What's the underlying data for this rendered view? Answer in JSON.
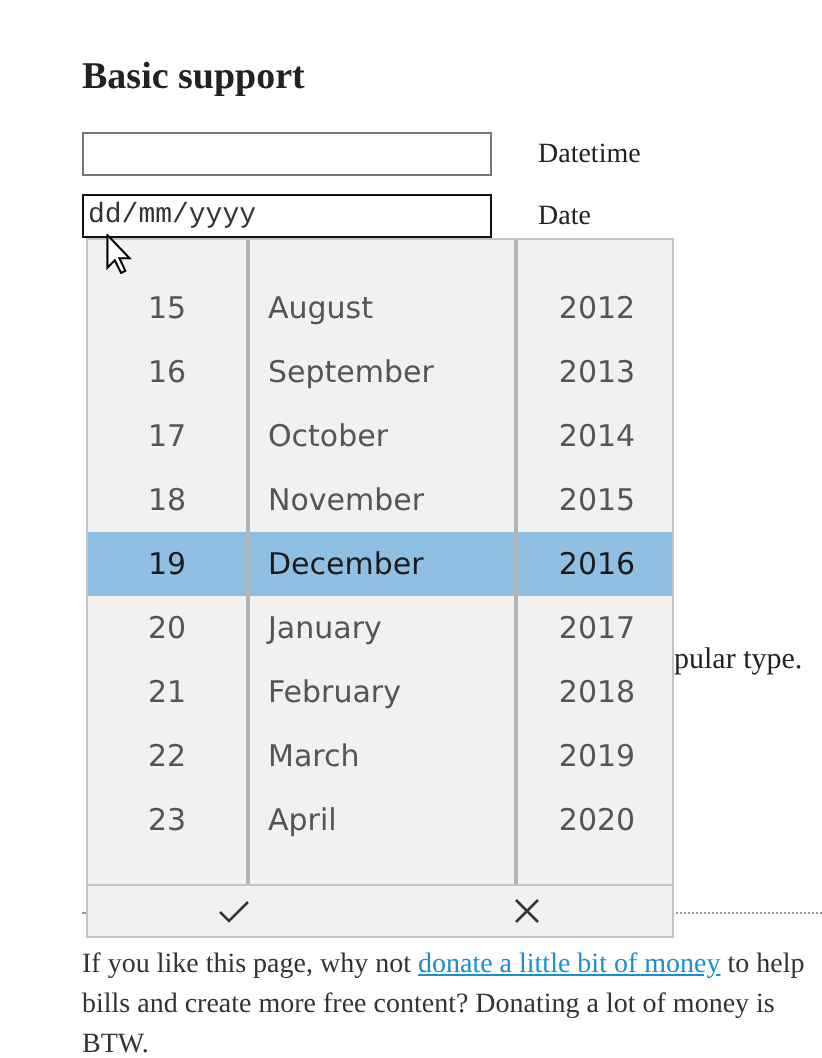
{
  "heading": "Basic support",
  "fields": [
    {
      "label": "Datetime",
      "focused": false
    },
    {
      "value": "dd/mm/yyyy",
      "label": "Date",
      "focused": true
    }
  ],
  "hidden_text": "pular type.",
  "note": {
    "before": "If you like this page, why not ",
    "link": "donate a little bit of money",
    "after": " to help\nbills and create more free content? Donating a lot of money is\nBTW."
  },
  "picker": {
    "days": [
      {
        "label": "15",
        "selected": false
      },
      {
        "label": "16",
        "selected": false
      },
      {
        "label": "17",
        "selected": false
      },
      {
        "label": "18",
        "selected": false
      },
      {
        "label": "19",
        "selected": true
      },
      {
        "label": "20",
        "selected": false
      },
      {
        "label": "21",
        "selected": false
      },
      {
        "label": "22",
        "selected": false
      },
      {
        "label": "23",
        "selected": false
      }
    ],
    "months": [
      {
        "label": "August",
        "selected": false
      },
      {
        "label": "September",
        "selected": false
      },
      {
        "label": "October",
        "selected": false
      },
      {
        "label": "November",
        "selected": false
      },
      {
        "label": "December",
        "selected": true
      },
      {
        "label": "January",
        "selected": false
      },
      {
        "label": "February",
        "selected": false
      },
      {
        "label": "March",
        "selected": false
      },
      {
        "label": "April",
        "selected": false
      }
    ],
    "years": [
      {
        "label": "2012",
        "selected": false
      },
      {
        "label": "2013",
        "selected": false
      },
      {
        "label": "2014",
        "selected": false
      },
      {
        "label": "2015",
        "selected": false
      },
      {
        "label": "2016",
        "selected": true
      },
      {
        "label": "2017",
        "selected": false
      },
      {
        "label": "2018",
        "selected": false
      },
      {
        "label": "2019",
        "selected": false
      },
      {
        "label": "2020",
        "selected": false
      }
    ]
  }
}
